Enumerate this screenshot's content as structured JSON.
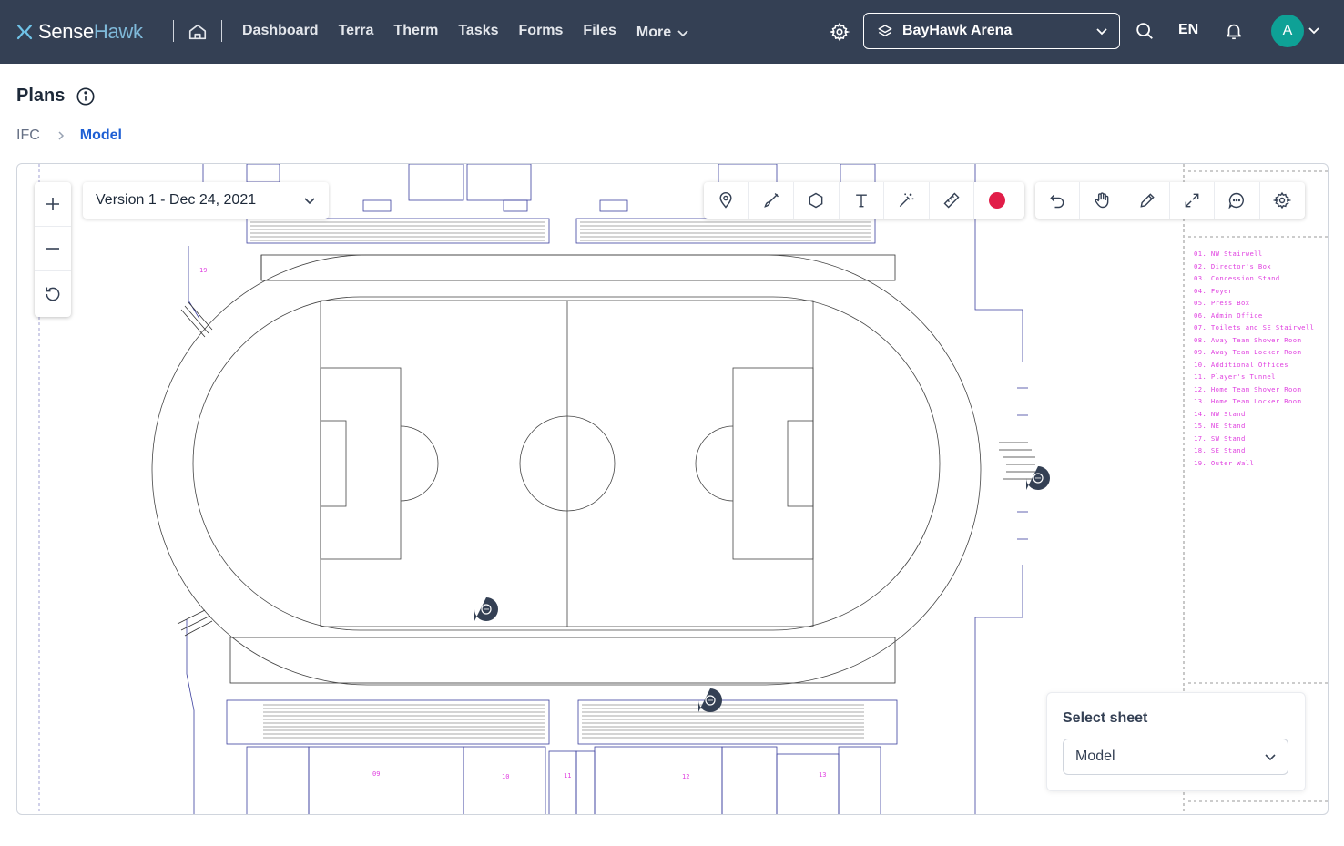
{
  "brand": {
    "sense": "Sense",
    "hawk": "Hawk"
  },
  "nav": {
    "items": [
      {
        "label": "Dashboard"
      },
      {
        "label": "Terra"
      },
      {
        "label": "Therm"
      },
      {
        "label": "Tasks"
      },
      {
        "label": "Forms"
      },
      {
        "label": "Files"
      }
    ],
    "more_label": "More"
  },
  "asset": {
    "name": "BayHawk Arena"
  },
  "language": "EN",
  "user": {
    "initial": "A"
  },
  "page": {
    "title": "Plans"
  },
  "breadcrumb": {
    "root": "IFC",
    "current": "Model"
  },
  "viewer": {
    "version_label": "Version 1 - Dec 24, 2021",
    "annotation_color": "#e11d48",
    "legend": [
      "01. NW Stairwell",
      "02. Director's Box",
      "03. Concession Stand",
      "04. Foyer",
      "05. Press Box",
      "06. Admin Office",
      "07. Toilets and SE Stairwell",
      "08. Away Team Shower Room",
      "09. Away Team Locker Room",
      "10. Additional Offices",
      "11. Player's Tunnel",
      "12. Home Team  Shower Room",
      "13. Home Team Locker Room",
      "14. NW Stand",
      "15. NE Stand",
      "17. SW Stand",
      "18. SE Stand",
      "19. Outer Wall"
    ],
    "room_labels": [
      "19",
      "09",
      "10",
      "11",
      "12",
      "13"
    ]
  },
  "sheet": {
    "title": "Select sheet",
    "selected": "Model"
  },
  "colors": {
    "nav_bg": "#344054",
    "accent": "#1e5fd4",
    "avatar": "#0ea196",
    "drawing_magenta": "#e040e0",
    "drawing_blue": "#3b3f9e"
  }
}
